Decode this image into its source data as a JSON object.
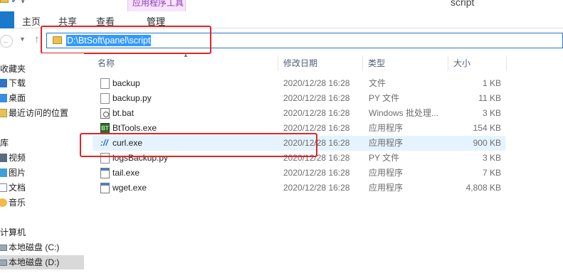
{
  "window": {
    "title": "script",
    "contextual_tab": "应用程序工具"
  },
  "ribbon": {
    "tabs": [
      "主页",
      "共享",
      "查看",
      "管理"
    ]
  },
  "address": {
    "path": "D:\\BtSoft\\panel\\script"
  },
  "navpane": {
    "items": [
      {
        "label": "收藏夹",
        "icon": "star-icon"
      },
      {
        "label": "下载",
        "icon": "download-folder-icon"
      },
      {
        "label": "桌面",
        "icon": "desktop-folder-icon"
      },
      {
        "label": "最近访问的位置",
        "icon": "recent-places-icon"
      },
      {
        "label": "库",
        "icon": "library-icon"
      },
      {
        "label": "视频",
        "icon": "videos-library-icon"
      },
      {
        "label": "图片",
        "icon": "pictures-library-icon"
      },
      {
        "label": "文档",
        "icon": "documents-library-icon"
      },
      {
        "label": "音乐",
        "icon": "music-library-icon"
      },
      {
        "label": "计算机",
        "icon": "computer-icon"
      },
      {
        "label": "本地磁盘 (C:)",
        "icon": "drive-icon"
      },
      {
        "label": "本地磁盘 (D:)",
        "icon": "drive-icon"
      }
    ]
  },
  "columns": {
    "name": "名称",
    "date": "修改日期",
    "type": "类型",
    "size": "大小"
  },
  "files": [
    {
      "name": "backup",
      "date": "2020/12/28 16:28",
      "type": "文件",
      "size": "1 KB",
      "icon": "generic-file-icon"
    },
    {
      "name": "backup.py",
      "date": "2020/12/28 16:28",
      "type": "PY 文件",
      "size": "11 KB",
      "icon": "python-file-icon"
    },
    {
      "name": "bt.bat",
      "date": "2020/12/28 16:28",
      "type": "Windows 批处理...",
      "size": "3 KB",
      "icon": "batch-file-icon"
    },
    {
      "name": "BtTools.exe",
      "date": "2020/12/28 16:28",
      "type": "应用程序",
      "size": "154 KB",
      "icon": "bttools-app-icon"
    },
    {
      "name": "curl.exe",
      "date": "2020/12/28 16:28",
      "type": "应用程序",
      "size": "900 KB",
      "icon": "curl-app-icon"
    },
    {
      "name": "logsBackup.py",
      "date": "2020/12/28 16:28",
      "type": "PY 文件",
      "size": "3 KB",
      "icon": "python-file-icon"
    },
    {
      "name": "tail.exe",
      "date": "2020/12/28 16:28",
      "type": "应用程序",
      "size": "7 KB",
      "icon": "app-exe-icon"
    },
    {
      "name": "wget.exe",
      "date": "2020/12/28 16:28",
      "type": "应用程序",
      "size": "4,808 KB",
      "icon": "app-exe-icon"
    }
  ],
  "colors": {
    "accent": "#1979ca",
    "selection": "#3399ff",
    "highlight_box": "#e0242b",
    "contextual_tab": "#f8e4ff"
  }
}
